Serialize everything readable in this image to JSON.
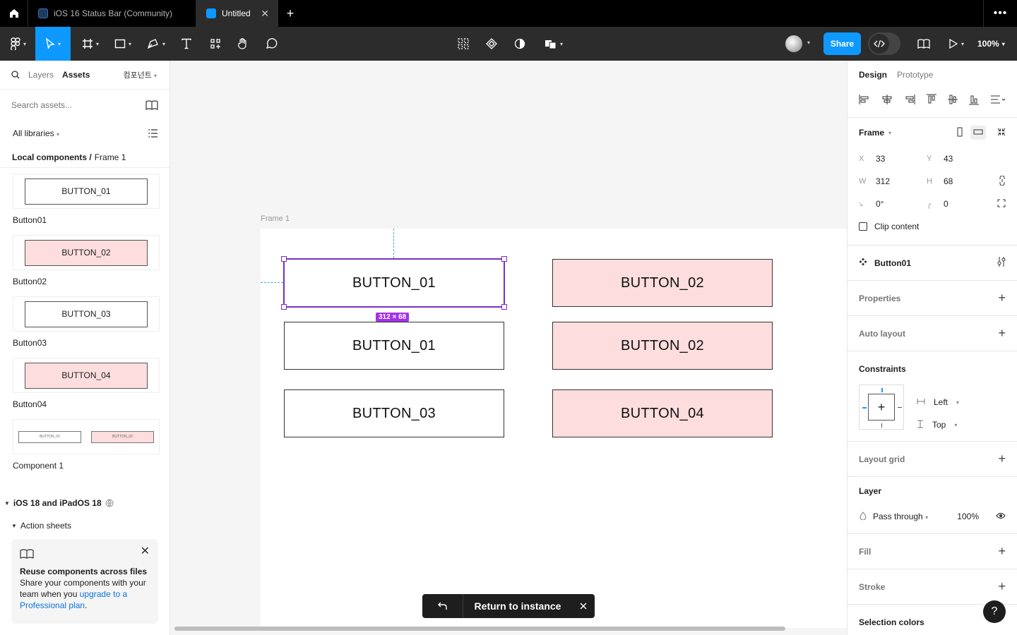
{
  "tabs": [
    {
      "label": "iOS 16 Status Bar (Community)"
    },
    {
      "label": "Untitled"
    }
  ],
  "toolbar": {
    "share_label": "Share",
    "zoom": "100%"
  },
  "left_panel": {
    "tab_layers": "Layers",
    "tab_assets": "Assets",
    "page_selector": "컴포넌트",
    "search_placeholder": "Search assets...",
    "library": "All libraries",
    "breadcrumb_root": "Local components /",
    "breadcrumb_current": "Frame 1",
    "components": [
      {
        "name": "Button01",
        "thumb_label": "BUTTON_01"
      },
      {
        "name": "Button02",
        "thumb_label": "BUTTON_02"
      },
      {
        "name": "Button03",
        "thumb_label": "BUTTON_03"
      },
      {
        "name": "Button04",
        "thumb_label": "BUTTON_04"
      },
      {
        "name": "Component 1",
        "thumb_a": "BUTTON_01",
        "thumb_b": "BUTTON_02"
      }
    ],
    "library_section": "iOS 18 and iPadOS 18",
    "subsection": "Action sheets",
    "promo": {
      "title": "Reuse components across files",
      "text": "Share your components with your team when you",
      "link": "upgrade to a Professional plan",
      "tail": "."
    }
  },
  "canvas": {
    "frame_label": "Frame 1",
    "buttons": [
      "BUTTON_01",
      "BUTTON_02",
      "BUTTON_01",
      "BUTTON_02",
      "BUTTON_03",
      "BUTTON_04"
    ],
    "selection_size": "312 × 68",
    "return_label": "Return to instance"
  },
  "right_panel": {
    "tab_design": "Design",
    "tab_prototype": "Prototype",
    "frame_label": "Frame",
    "x": "33",
    "y": "43",
    "w": "312",
    "h": "68",
    "rotation": "0°",
    "radius": "0",
    "clip_content": "Clip content",
    "instance_name": "Button01",
    "properties": "Properties",
    "auto_layout": "Auto layout",
    "constraints": "Constraints",
    "constraint_h": "Left",
    "constraint_v": "Top",
    "layout_grid": "Layout grid",
    "layer": "Layer",
    "blend": "Pass through",
    "opacity": "100%",
    "fill": "Fill",
    "stroke": "Stroke",
    "selection_colors": "Selection colors",
    "help": "?"
  },
  "colors": {
    "accent": "#0d99ff",
    "selection": "#7b2fbf",
    "pink_fill": "#fddddd"
  }
}
